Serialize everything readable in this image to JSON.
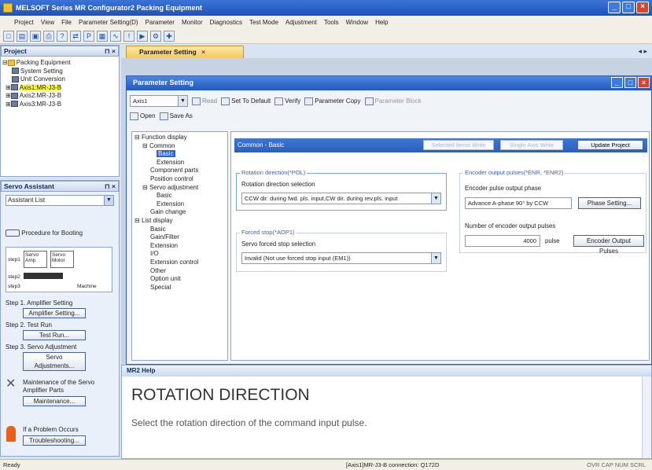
{
  "window": {
    "title": "MELSOFT Series MR Configurator2 Packing Equipment"
  },
  "menu": [
    "Project",
    "View",
    "File",
    "Parameter Setting(D)",
    "Parameter",
    "Monitor",
    "Diagnostics",
    "Test Mode",
    "Adjustment",
    "Tools",
    "Window",
    "Help"
  ],
  "project_panel": {
    "title": "Project",
    "tree": [
      "Packing Equipment",
      "System Setting",
      "Unit Conversion",
      "Axis1:MR-J3-B",
      "Axis2:MR-J3-B",
      "Axis3:MR-J3-B"
    ]
  },
  "servo_assistant": {
    "title": "Servo Assistant",
    "dropdown": "Assistant List",
    "procedure": "Procedure for Booting",
    "diagram": {
      "step1": "step1",
      "step2": "step2",
      "step3": "step3",
      "amp": "Servo Amp",
      "motor": "Servo Motor",
      "machine": "Machine"
    },
    "steps": [
      {
        "label": "Step 1. Amplifier Setting",
        "button": "Amplifier Setting..."
      },
      {
        "label": "Step 2. Test Run",
        "button": "Test Run..."
      },
      {
        "label": "Step 3. Servo Adjustment",
        "button": "Servo Adjustments..."
      }
    ],
    "maintenance": {
      "text": "Maintenance of the Servo Amplifier Parts",
      "button": "Maintenance..."
    },
    "trouble": {
      "text": "If a Problem Occurs",
      "button": "Troubleshooting..."
    }
  },
  "doc_tab": {
    "label": "Parameter Setting",
    "nav": "◂ ▸"
  },
  "param_window": {
    "title": "Parameter Setting",
    "axis": "Axis1",
    "toolbar": [
      "Read",
      "Set To Default",
      "Verify",
      "Parameter Copy",
      "Parameter Block"
    ],
    "toolbar2": [
      "Open",
      "Save As"
    ],
    "tree": [
      "Function display",
      "Common",
      "Basic",
      "Extension",
      "Component parts",
      "Position control",
      "Servo adjustment",
      "Basic",
      "Extension",
      "Gain change",
      "List display",
      "Basic",
      "Gain/Filter",
      "Extension",
      "I/O",
      "Extension control",
      "Other",
      "Option unit",
      "Special"
    ],
    "content": {
      "header": "Common - Basic",
      "selected_items_write": "Selected Items Write",
      "single_axis_write": "Single Axis Write",
      "update_project": "Update Project",
      "rotation": {
        "group": "Rotation direction(*POL)",
        "label": "Rotation direction selection",
        "value": "CCW dir. during fwd. pls. input,CW dir. during rev.pls. input"
      },
      "forced_stop": {
        "group": "Forced stop(*AOP1)",
        "label": "Servo forced stop selection",
        "value": "Invalid (Not use forced stop input (EM1))"
      },
      "encoder": {
        "group": "Encoder output pulses(*ENR, *ENR2)",
        "phase_label": "Encoder pulse output phase",
        "phase_value": "Advance A-phase 90° by CCW",
        "phase_button": "Phase Setting...",
        "count_label": "Number of encoder output pulses",
        "count_value": "4000",
        "unit": "pulse",
        "count_button": "Encoder Output Pulses"
      }
    }
  },
  "help": {
    "title": "MR2 Help",
    "heading": "ROTATION DIRECTION",
    "body": "Select the rotation direction of the command input pulse."
  },
  "status": {
    "left": "Ready",
    "center": "[Axis1]MR-J3-B connection: Q172D",
    "right": "OVR CAP NUM SCRL"
  }
}
